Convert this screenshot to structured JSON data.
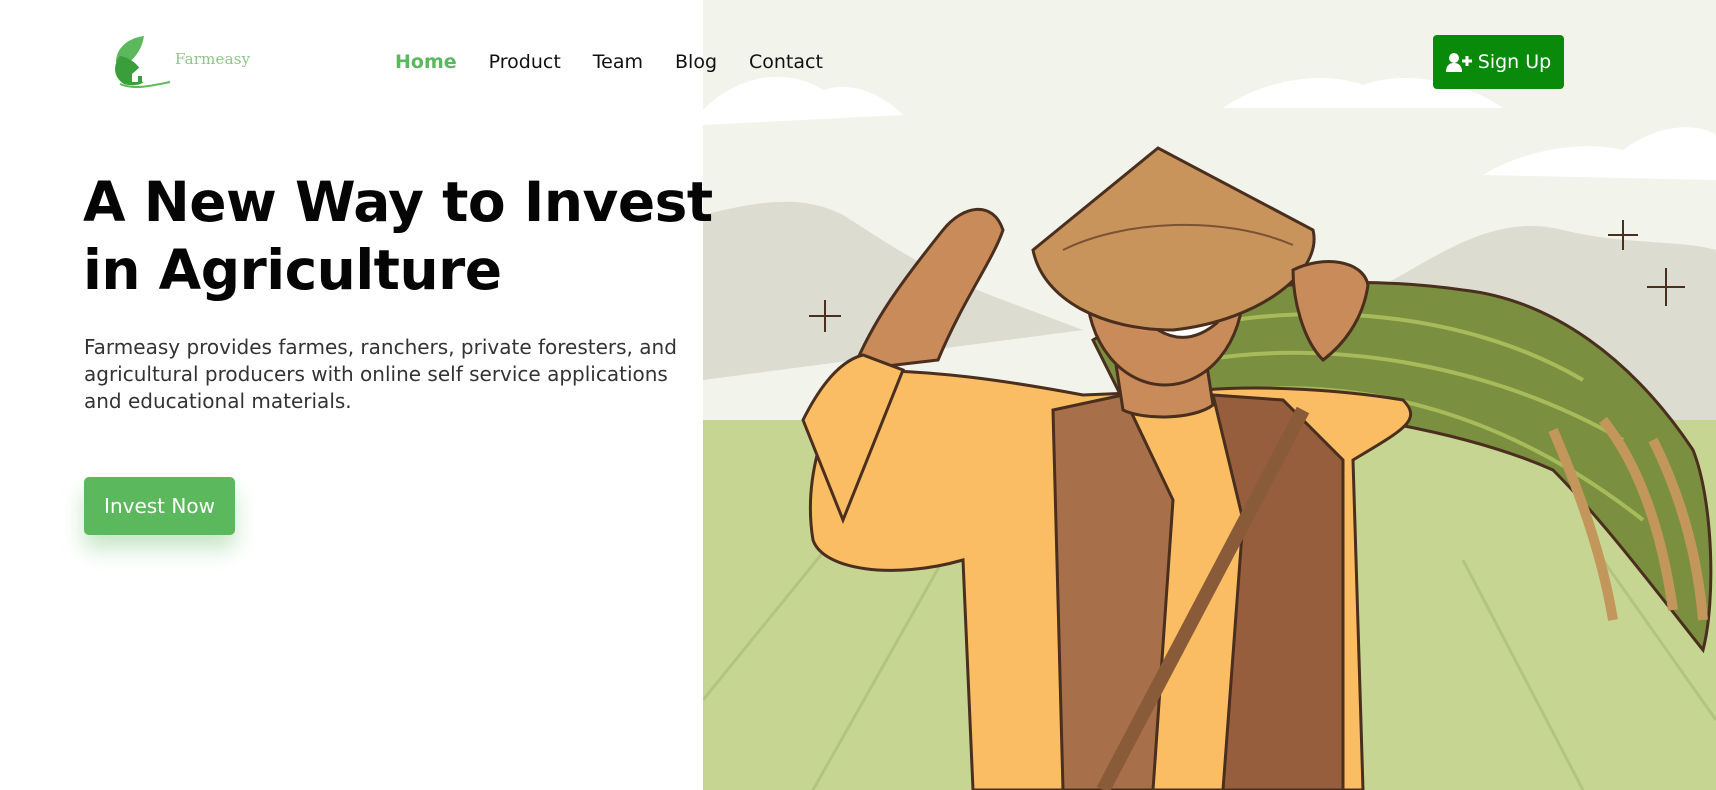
{
  "brand": {
    "name": "Farmeasy"
  },
  "nav": {
    "items": [
      {
        "label": "Home",
        "active": true
      },
      {
        "label": "Product",
        "active": false
      },
      {
        "label": "Team",
        "active": false
      },
      {
        "label": "Blog",
        "active": false
      },
      {
        "label": "Contact",
        "active": false
      }
    ]
  },
  "header": {
    "signup_label": "Sign Up",
    "signup_icon": "user-plus-icon"
  },
  "hero": {
    "title_line1": "A New Way to Invest",
    "title_line2": "in Agriculture",
    "description": "Farmeasy provides farmes, ranchers, private foresters, and agricultural producers with online self service applications and educational materials.",
    "cta_label": "Invest Now",
    "illustration": "farmer-with-rice-harvest"
  },
  "colors": {
    "accent": "#5cb85c",
    "signup_bg": "#0a8a0a",
    "field": "#c6d692",
    "sky": "#f2f3ea",
    "shirt": "#fbbd63",
    "vest": "#a8704a"
  }
}
